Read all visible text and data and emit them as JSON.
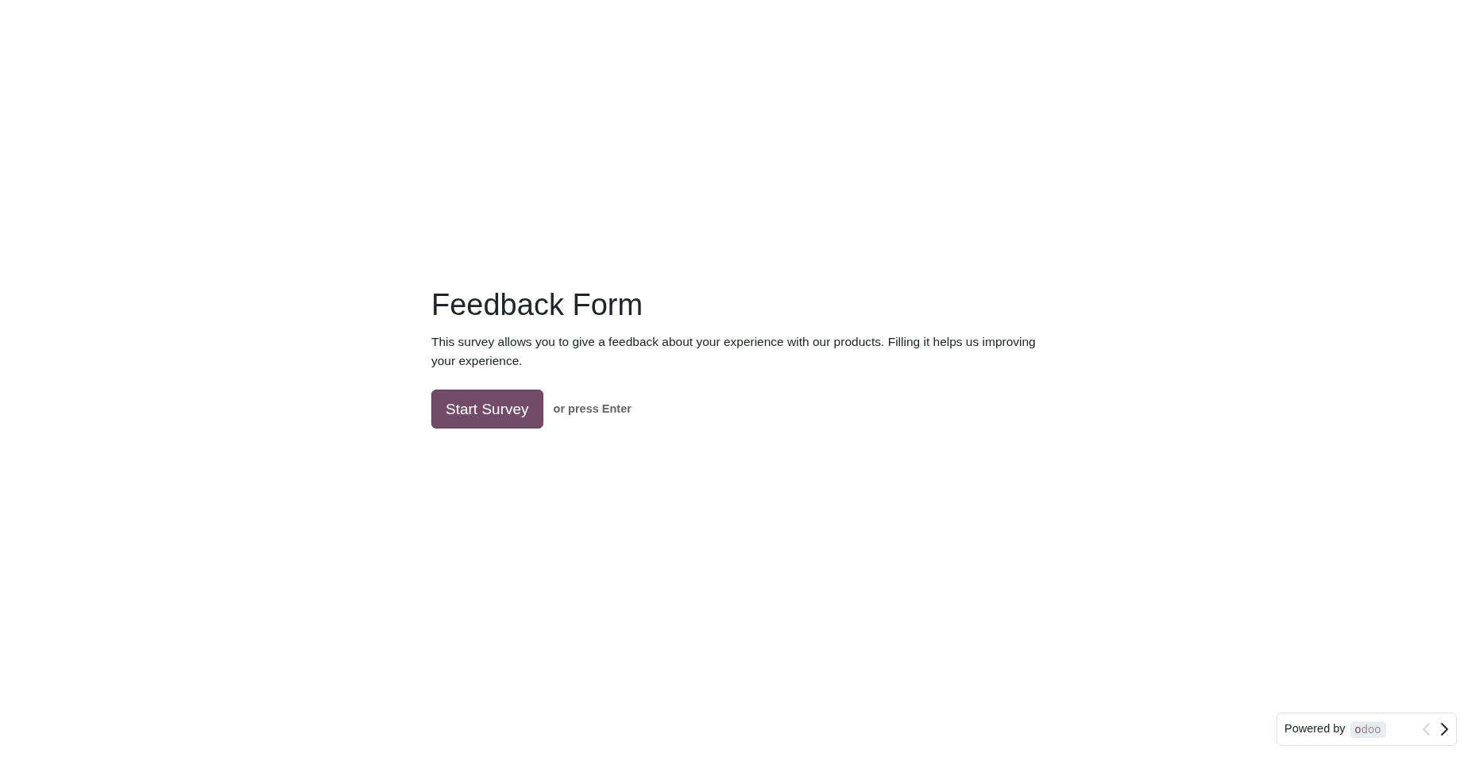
{
  "survey": {
    "title": "Feedback Form",
    "description": "This survey allows you to give a feedback about your experience with our products. Filling it helps us improving your experience.",
    "start_button": "Start Survey",
    "hint": "or press Enter"
  },
  "footer": {
    "powered_by": "Powered by",
    "logo": "odoo",
    "prev_button": {
      "disabled": true
    },
    "next_button": {
      "disabled": false
    }
  }
}
